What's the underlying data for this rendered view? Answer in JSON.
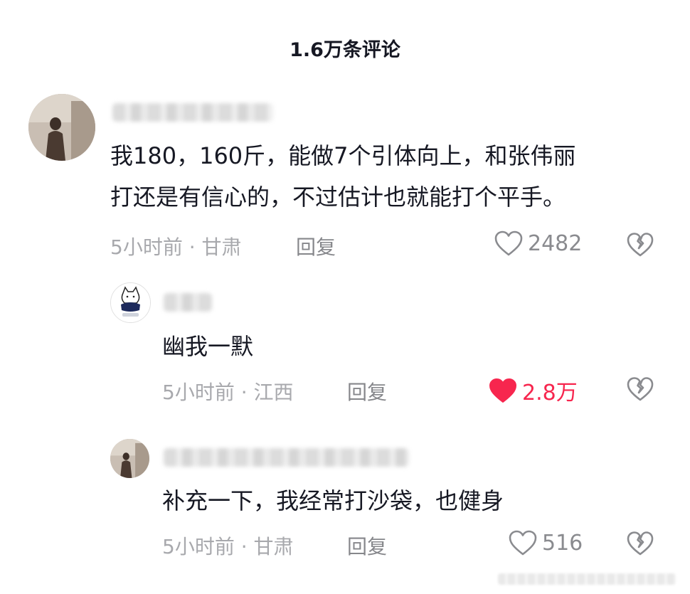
{
  "header": {
    "title": "1.6万条评论"
  },
  "comments": [
    {
      "text_lines": [
        "我180，160斤，能做7个引体向上，和张伟丽",
        "打还是有信心的，不过估计也就能打个平手。"
      ],
      "meta": "5小时前 · 甘肃",
      "reply_label": "回复",
      "likes": "2482",
      "liked": false
    },
    {
      "text_lines": [
        "幽我一默"
      ],
      "meta": "5小时前 · 江西",
      "reply_label": "回复",
      "likes": "2.8万",
      "liked": true
    },
    {
      "text_lines": [
        "补充一下，我经常打沙袋，也健身"
      ],
      "meta": "5小时前 · 甘肃",
      "reply_label": "回复",
      "likes": "516",
      "liked": false
    }
  ],
  "colors": {
    "liked": "#f7264e",
    "meta": "#a8a9ad",
    "text": "#161823"
  },
  "icons": {
    "like": "heart-icon",
    "dislike": "broken-heart-icon"
  }
}
